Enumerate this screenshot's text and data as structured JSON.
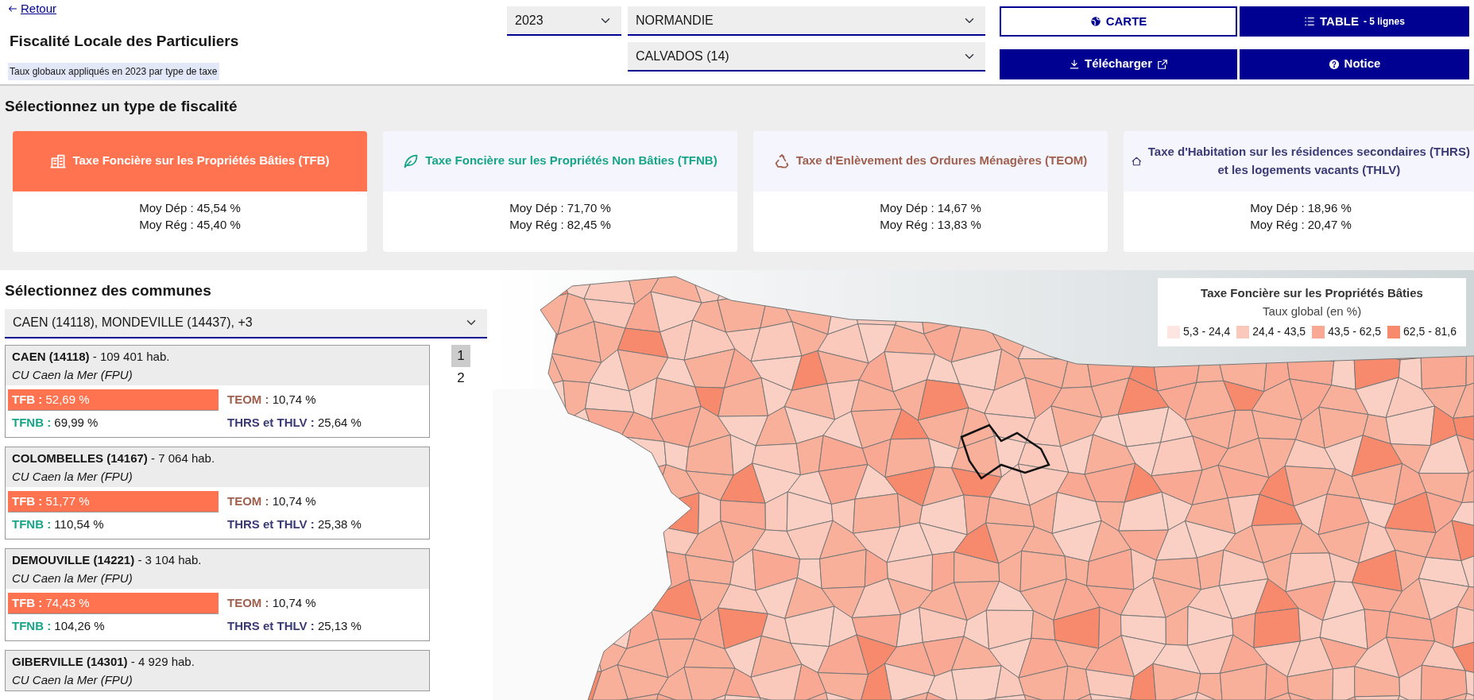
{
  "header": {
    "back_link": "Retour",
    "title": "Fiscalité Locale des Particuliers",
    "subtitle": "Taux globaux appliqués en 2023 par type de taxe"
  },
  "filters": {
    "year": "2023",
    "region": "NORMANDIE",
    "department": "CALVADOS (14)"
  },
  "view_buttons": [
    {
      "kind": "globe",
      "label": "CARTE",
      "selected": true
    },
    {
      "kind": "list",
      "label": "TABLE",
      "count": "- 5 lignes",
      "selected": false
    }
  ],
  "action_buttons": [
    {
      "kind": "download",
      "label": "Télécharger",
      "external": true
    },
    {
      "kind": "help",
      "label": "Notice",
      "external": false
    }
  ],
  "tax_section": {
    "heading": "Sélectionnez un type de fiscalité",
    "cards": [
      {
        "kind": "building",
        "title": "Taxe Foncière sur les Propriétés Bâties (TFB)",
        "color": "#ff7350",
        "selected": true,
        "dep": "Moy Dép : 45,54 %",
        "reg": "Moy Rég : 45,40 %"
      },
      {
        "kind": "leaf",
        "title": "Taxe Foncière sur les Propriétés Non Bâties (TFNB)",
        "color": "#17a589",
        "selected": false,
        "dep": "Moy Dép : 71,70 %",
        "reg": "Moy Rég : 82,45 %"
      },
      {
        "kind": "recycle",
        "title": "Taxe d'Enlèvement des Ordures Ménagères (TEOM)",
        "color": "#a0604e",
        "selected": false,
        "dep": "Moy Dép : 14,67 %",
        "reg": "Moy Rég : 13,83 %"
      },
      {
        "kind": "house",
        "title": "Taxe d'Habitation sur les résidences secondaires (THRS) et les logements vacants (THLV)",
        "color": "#3a3a75",
        "selected": false,
        "dep": "Moy Dép : 18,96 %",
        "reg": "Moy Rég : 20,47 %"
      }
    ]
  },
  "communes_section": {
    "heading": "Sélectionnez des communes",
    "selection": "CAEN (14118), MONDEVILLE (14437), +3",
    "pages": [
      {
        "label": "1",
        "selected": true
      },
      {
        "label": "2",
        "selected": false
      }
    ],
    "communes": [
      {
        "name": "CAEN (14118)",
        "population": "- 109 401 hab.",
        "epci": "CU Caen la Mer (FPU)",
        "taxes": [
          {
            "label": "TFB :",
            "value": "52,69 %",
            "color": "#ff7350",
            "selected": true
          },
          {
            "label": "TEOM :",
            "value": "10,74 %",
            "color": "#a0604e",
            "selected": false
          },
          {
            "label": "TFNB :",
            "value": "69,99 %",
            "color": "#17a589",
            "selected": false
          },
          {
            "label": "THRS et THLV :",
            "value": "25,64 %",
            "color": "#3a3a75",
            "selected": false
          }
        ]
      },
      {
        "name": "COLOMBELLES (14167)",
        "population": "- 7 064 hab.",
        "epci": "CU Caen la Mer (FPU)",
        "taxes": [
          {
            "label": "TFB :",
            "value": "51,77 %",
            "color": "#ff7350",
            "selected": true
          },
          {
            "label": "TEOM :",
            "value": "10,74 %",
            "color": "#a0604e",
            "selected": false
          },
          {
            "label": "TFNB :",
            "value": "110,54 %",
            "color": "#17a589",
            "selected": false
          },
          {
            "label": "THRS et THLV :",
            "value": "25,38 %",
            "color": "#3a3a75",
            "selected": false
          }
        ]
      },
      {
        "name": "DEMOUVILLE (14221)",
        "population": "- 3 104 hab.",
        "epci": "CU Caen la Mer (FPU)",
        "taxes": [
          {
            "label": "TFB :",
            "value": "74,43 %",
            "color": "#ff7350",
            "selected": true
          },
          {
            "label": "TEOM :",
            "value": "10,74 %",
            "color": "#a0604e",
            "selected": false
          },
          {
            "label": "TFNB :",
            "value": "104,26 %",
            "color": "#17a589",
            "selected": false
          },
          {
            "label": "THRS et THLV :",
            "value": "25,13 %",
            "color": "#3a3a75",
            "selected": false
          }
        ]
      },
      {
        "name": "GIBERVILLE (14301)",
        "population": "- 4 929 hab.",
        "epci": "CU Caen la Mer (FPU)"
      }
    ]
  },
  "map": {
    "legend": {
      "title": "Taxe Foncière sur les Propriétés Bâties",
      "subtitle": "Taux global (en %)",
      "items": [
        {
          "label": "5,3 - 24,4",
          "color": "#fde6e1"
        },
        {
          "label": "24,4 - 43,5",
          "color": "#fbc9bb"
        },
        {
          "label": "43,5 - 62,5",
          "color": "#f9a893"
        },
        {
          "label": "62,5 - 81,6",
          "color": "#f7896d"
        }
      ]
    }
  }
}
